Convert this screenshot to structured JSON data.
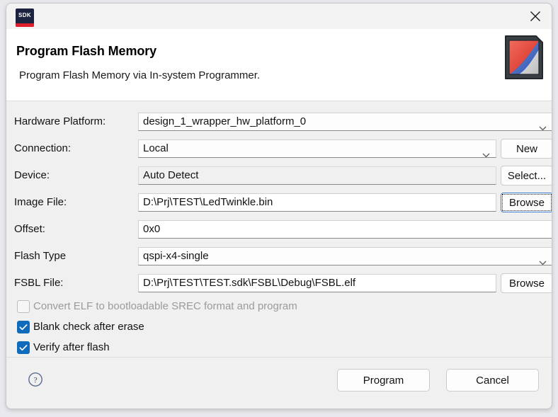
{
  "window": {
    "app_icon_text": "SDK",
    "close_icon": "close-icon"
  },
  "header": {
    "title": "Program Flash Memory",
    "description": "Program Flash Memory via In-system Programmer.",
    "logo_icon": "xilinx-sdk-card-logo"
  },
  "form": {
    "rows": [
      {
        "label": "Hardware Platform:",
        "value": "design_1_wrapper_hw_platform_0",
        "control": "combo",
        "button": null
      },
      {
        "label": "Connection:",
        "value": "Local",
        "control": "combo",
        "button": "New"
      },
      {
        "label": "Device:",
        "value": "Auto Detect",
        "control": "readonly",
        "button": "Select..."
      },
      {
        "label": "Image File:",
        "value": "D:\\Prj\\TEST\\LedTwinkle.bin",
        "control": "text",
        "button": "Browse"
      },
      {
        "label": "Offset:",
        "value": "0x0",
        "control": "text",
        "button": null
      },
      {
        "label": "Flash Type",
        "value": "qspi-x4-single",
        "control": "combo",
        "button": null
      },
      {
        "label": "FSBL File:",
        "value": "D:\\Prj\\TEST\\TEST.sdk\\FSBL\\Debug\\FSBL.elf",
        "control": "text",
        "button": "Browse"
      }
    ],
    "checkboxes": [
      {
        "label": "Convert ELF to bootloadable SREC format and program",
        "checked": false,
        "disabled": true
      },
      {
        "label": "Blank check after erase",
        "checked": true,
        "disabled": false
      },
      {
        "label": "Verify after flash",
        "checked": true,
        "disabled": false
      }
    ]
  },
  "footer": {
    "help_icon": "help-question-icon",
    "program_label": "Program",
    "cancel_label": "Cancel"
  },
  "colors": {
    "accent": "#0f6cbd",
    "focus_border": "#3b7fd4",
    "dialog_bg": "#f0f0f0",
    "header_bg": "#ffffff",
    "sdk_icon_bg": "#1b2340",
    "sdk_icon_bar": "#e01f2d"
  }
}
